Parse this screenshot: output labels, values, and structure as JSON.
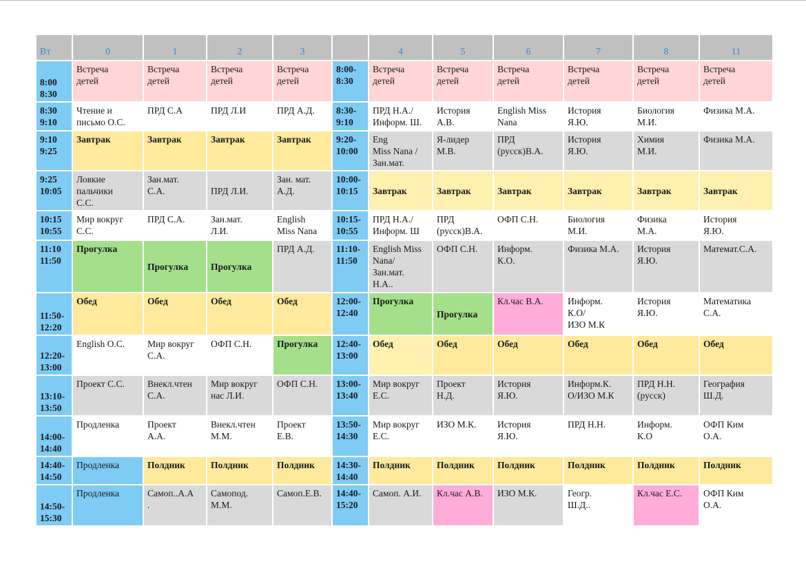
{
  "header": {
    "day": "Вт",
    "columns": [
      "0",
      "1",
      "2",
      "3",
      "",
      "4",
      "5",
      "6",
      "7",
      "8",
      "11"
    ]
  },
  "rows": [
    {
      "time_left": "8:00\n8:30",
      "left": [
        "Встреча\nдетей",
        "Встреча\nдетей",
        "Встреча\nдетей",
        "Встреча\nдетей"
      ],
      "time_right": "8:00-\n8:30",
      "right": [
        "Встреча\nдетей",
        "Встреча\nдетей",
        "Встреча\nдетей",
        "Встреча\nдетей",
        "Встреча\nдетей",
        "Встреча\nдетей"
      ]
    },
    {
      "time_left": "8:30\n9:10",
      "left": [
        "Чтение и\nписьмо О.С.",
        "ПРД С.А",
        "ПРД Л.И",
        "ПРД А.Д."
      ],
      "time_right": "8:30-\n9:10",
      "right": [
        "ПРД Н.А./\nИнформ. Ш.",
        "История\nА.В.",
        "English Miss\nNana",
        "История\nЯ.Ю.",
        "Биология\nМ.И.",
        "Физика М.А."
      ]
    },
    {
      "time_left": "9:10\n9:25",
      "left": [
        "Завтрак",
        "Завтрак",
        "Завтрак",
        "Завтрак"
      ],
      "time_right": "9:20-\n10:00",
      "right": [
        "Eng\nMiss Nana /\nЗан.мат.",
        "Я-лидер\nМ.В.",
        "ПРД\n(русск)В.А.",
        "История\nЯ.Ю.",
        "Химия\nМ.И.",
        "Физика М.А."
      ]
    },
    {
      "time_left": "9:25\n10:05",
      "left": [
        "Ловкие\nпальчики\nС.С.",
        "Зан.мат.\nС.А.",
        "ПРД Л.И.",
        "Зан. мат.\nА.Д."
      ],
      "time_right": "10:00-\n10:15",
      "right": [
        "Завтрак",
        "Завтрак",
        "Завтрак",
        "Завтрак",
        "Завтрак",
        "Завтрак"
      ]
    },
    {
      "time_left": "10:15\n10:55",
      "left": [
        "Мир вокруг\nС.С.",
        "ПРД С.А.",
        "Зан.мат.\nЛ.И.",
        "English\nMiss Nana"
      ],
      "time_right": "10:15-\n10:55",
      "right": [
        "ПРД Н.А./\nИнформ. Ш",
        "ПРД\n(русск)В.А.",
        "ОФП С.Н.",
        "Биология\nМ.И.",
        "Физика\nМ.А.",
        "История\nЯ.Ю."
      ]
    },
    {
      "time_left": "11:10\n11:50",
      "left": [
        "Прогулка",
        "Прогулка",
        "Прогулка",
        "ПРД А.Д."
      ],
      "time_right": "11:10-\n11:50",
      "right": [
        "English Miss\nNana/\nЗан.мат.\nН.А..",
        "ОФП С.Н.",
        "Информ.\nК.О.",
        "Физика М.А.",
        "История\nЯ.Ю.",
        "Математ.С.А."
      ]
    },
    {
      "time_left": "11:50-\n12:20",
      "left": [
        "Обед",
        "Обед",
        "Обед",
        "Обед"
      ],
      "time_right": "12:00-\n12:40",
      "right": [
        "Прогулка",
        "Прогулка",
        "Кл.час В.А.",
        "Информ.\nК.О/\nИЗО М.К",
        "История\nЯ.Ю.",
        "Математика\nС.А."
      ]
    },
    {
      "time_left": "12:20-\n13:00",
      "left": [
        "English О.С.",
        "Мир вокруг\nС.А.",
        "ОФП С.Н.",
        "Прогулка"
      ],
      "time_right": "12:40-\n13:00",
      "right": [
        "Обед",
        "Обед",
        "Обед",
        "Обед",
        "Обед",
        "Обед"
      ]
    },
    {
      "time_left": "13:10-\n13:50",
      "left": [
        "Проект С.С.",
        "Внекл.чтен\nС.А.",
        "Мир вокруг\nнас Л.И.",
        "ОФП С.Н."
      ],
      "time_right": "13:00-\n13:40",
      "right": [
        "Мир вокруг\nЕ.С.",
        "Проект\nН.Д.",
        "История\nЯ.Ю.",
        "Информ.К.\nО/ИЗО М.К",
        "ПРД Н.Н.\n(русск)",
        "География\nШ.Д."
      ]
    },
    {
      "time_left": "14:00-\n14:40",
      "left": [
        "Продленка",
        "Проект\nА.А.",
        "Внекл.чтен\nМ.М.",
        "Проект\nЕ.В."
      ],
      "time_right": "13:50-\n14:30",
      "right": [
        "Мир вокруг\nЕ.С.",
        "ИЗО М.К.",
        "История\nЯ.Ю.",
        "ПРД Н.Н.",
        "Информ.\nК.О",
        "ОФП Ким\nО.А."
      ]
    },
    {
      "time_left": "14:40-\n14:50",
      "left": [
        "Продленка",
        "Полдник",
        "Полдник",
        "Полдник"
      ],
      "time_right": "14:30-\n14:40",
      "right": [
        "Полдник",
        "Полдник",
        "Полдник",
        "Полдник",
        "Полдник",
        "Полдник"
      ]
    },
    {
      "time_left": "14:50-\n15:30",
      "left": [
        "Продленка",
        "Самоп..А.А\n.",
        "Самопод.\nМ.М.",
        "Самоп.Е.В."
      ],
      "time_right": "14:40-\n15:20",
      "right": [
        "Самоп. А.И.",
        "Кл.час А.В.",
        "ИЗО М.К.",
        "Геогр.\nШ.Д..",
        "Кл.час Е.С.",
        "ОФП Ким\nО.А."
      ]
    }
  ],
  "colors": {
    "header": "#c0c0c0",
    "header_text": "#3a86c8",
    "time": "#7ecbf4",
    "arrival": "#ffd5d5",
    "gray": "#d9d9d9",
    "meal": "#ffe99c",
    "walk": "#a4e08a",
    "class_hour": "#ffacd9"
  }
}
